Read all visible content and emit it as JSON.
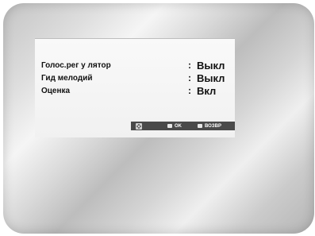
{
  "settings": [
    {
      "label": "Голос.рег у лятор",
      "colon": ":",
      "value": "Выкл"
    },
    {
      "label": "Гид мелодий",
      "colon": ":",
      "value": "Выкл"
    },
    {
      "label": "Оценка",
      "colon": ":",
      "value": "Вкл"
    }
  ],
  "hints": {
    "move_icon": "directional-pad-icon",
    "ok_label": "OK",
    "back_label": "ВОЗВР"
  },
  "colors": {
    "panel_bg": "#f4f4f4",
    "hint_bar_bg": "#4a4a4a",
    "text": "#111111"
  }
}
